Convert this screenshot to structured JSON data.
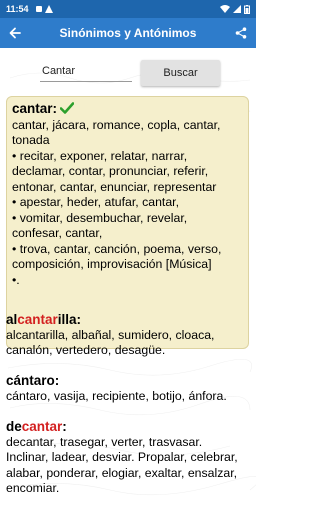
{
  "status": {
    "time": "11:54"
  },
  "app": {
    "title": "Sinónimos y Antónimos"
  },
  "search": {
    "value": "Cantar",
    "button_label": "Buscar"
  },
  "main_entry": {
    "headword": "cantar:",
    "lines": [
      "cantar, jácara, romance, copla, cantar,",
      "tonada",
      "• recitar, exponer, relatar, narrar,",
      "declamar, contar, pronunciar, referir,",
      "entonar, cantar, enunciar, representar",
      "• apestar, heder, atufar, cantar,",
      "• vomitar, desembuchar, revelar,",
      "confesar, cantar,",
      "• trova, cantar, canción, poema, verso,",
      "composición, improvisación [Música]",
      "•."
    ]
  },
  "entry_alcantarilla": {
    "head_prefix": "al",
    "head_match": "cantar",
    "head_suffix": "illa:",
    "lines": [
      "alcantarilla, albañal, sumidero, cloaca,",
      "canalón, vertedero, desagüe."
    ]
  },
  "entry_cantaro": {
    "headword": "cántaro:",
    "lines": [
      "cántaro, vasija, recipiente, botijo, ánfora."
    ]
  },
  "entry_decantar": {
    "head_prefix": "de",
    "head_match": "cantar",
    "head_suffix": ":",
    "lines": [
      "decantar, trasegar, verter, trasvasar.",
      "Inclinar, ladear, desviar. Propalar, celebrar,",
      "alabar, ponderar, elogiar, exaltar, ensalzar,",
      "encomiar."
    ]
  },
  "colors": {
    "status_bar": "#1e66ad",
    "app_bar": "#2e7ccb",
    "highlight_bg": "#f5efcc",
    "match_red": "#d32020",
    "check_green": "#2ca02c"
  }
}
